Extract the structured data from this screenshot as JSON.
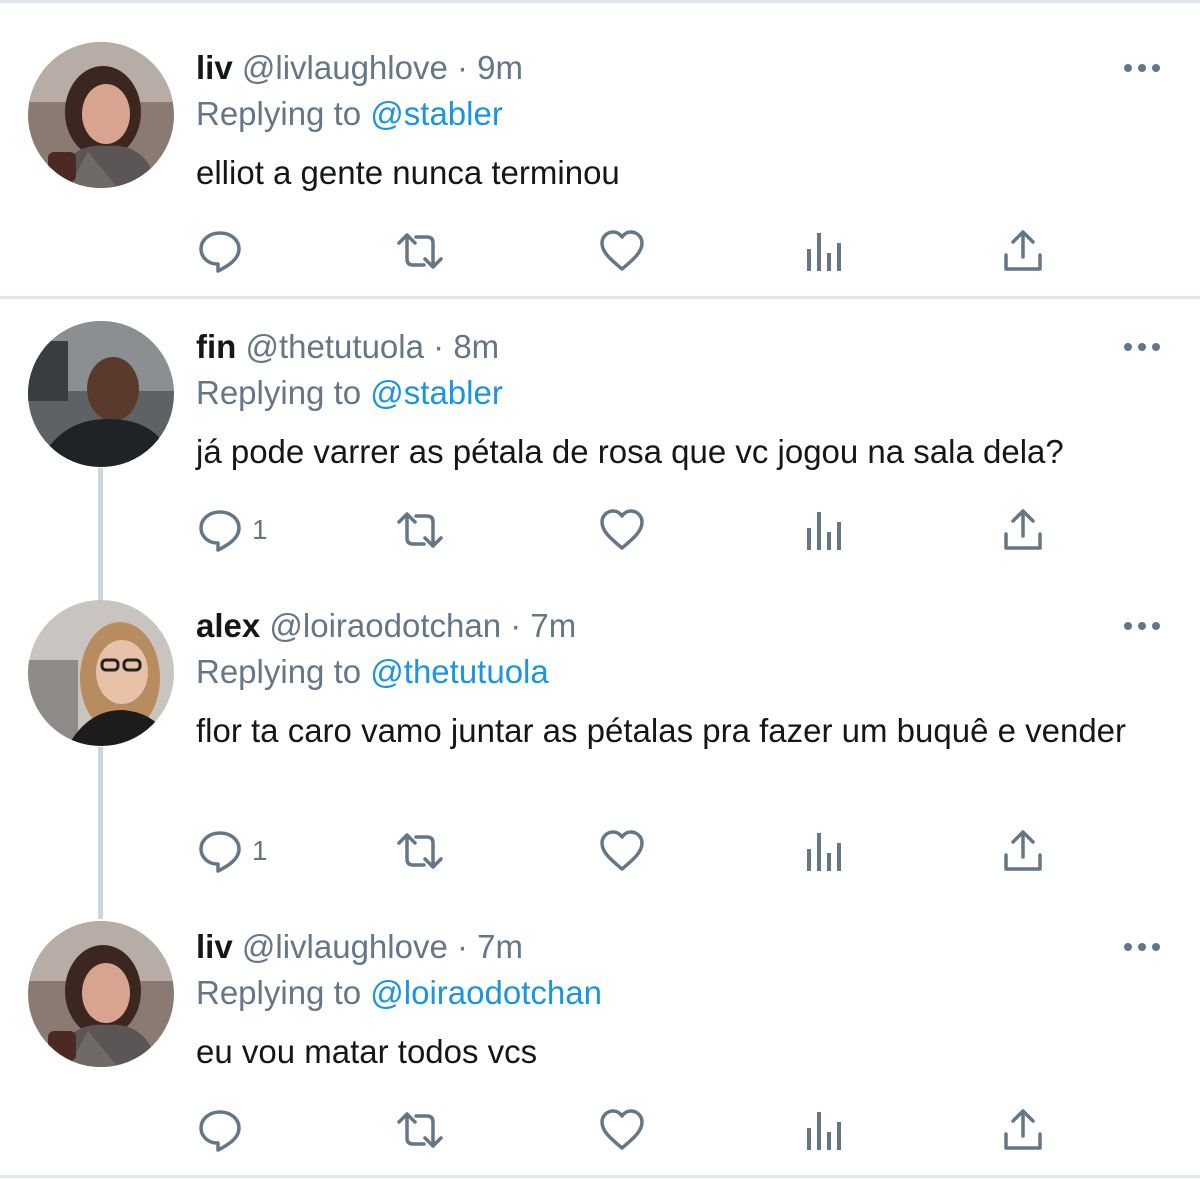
{
  "tweets": [
    {
      "name": "liv",
      "handle": "@livlaughlove",
      "time": "9m",
      "replying_prefix": "Replying to",
      "replying_to": "@stabler",
      "text": "elliot a gente nunca terminou",
      "reply_count": ""
    },
    {
      "name": "fin",
      "handle": "@thetutuola",
      "time": "8m",
      "replying_prefix": "Replying to",
      "replying_to": "@stabler",
      "text": "já pode varrer as pétala de rosa que vc jogou na sala dela?",
      "reply_count": "1"
    },
    {
      "name": "alex",
      "handle": "@loiraodotchan",
      "time": "7m",
      "replying_prefix": "Replying to",
      "replying_to": "@thetutuola",
      "text": "flor ta caro vamo juntar as pétalas pra fazer um buquê e vender",
      "reply_count": "1"
    },
    {
      "name": "liv",
      "handle": "@livlaughlove",
      "time": "7m",
      "replying_prefix": "Replying to",
      "replying_to": "@loiraodotchan",
      "text": "eu vou matar todos vcs",
      "reply_count": ""
    }
  ],
  "separator": "·",
  "icons": {
    "reply": "reply-bubble-icon",
    "retweet": "retweet-arrows-icon",
    "like": "heart-outline-icon",
    "analytics": "analytics-bars-icon",
    "share": "share-upload-icon",
    "more": "more-horizontal-icon"
  },
  "colors": {
    "text": "#14171a",
    "secondary": "#657786",
    "link": "#1b95e0",
    "thread_line": "#ccd6dd",
    "divider": "#e1e8ed"
  }
}
